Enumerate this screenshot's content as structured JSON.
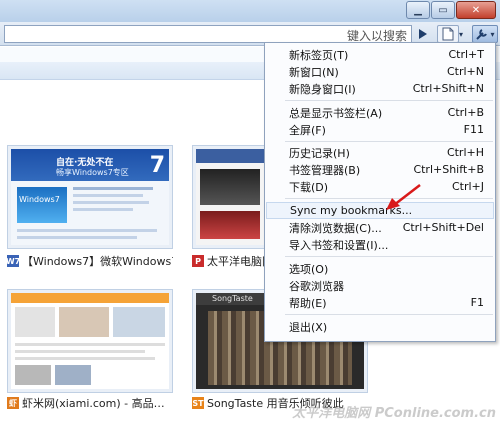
{
  "toolbar": {
    "search_hint": "键入以搜索",
    "window_buttons": [
      "▁",
      "▭",
      "✕"
    ]
  },
  "thumbnails": [
    {
      "caption": "【Windows7】微软Windows7…",
      "favicon": "W7",
      "fav_color": "#3a63b6"
    },
    {
      "caption": "太平洋电脑网",
      "favicon": "P",
      "fav_color": "#c92b2b"
    },
    {
      "caption": "虾米网(xiami.com) - 高品…",
      "favicon": "虾",
      "fav_color": "#e07a1c"
    },
    {
      "caption": "SongTaste 用音乐倾听彼此",
      "favicon": "ST",
      "fav_color": "#e8841a"
    }
  ],
  "thumb_content": {
    "win7_banner": "自在·无处不在",
    "win7_sub": "畅享Windows7专区",
    "win7_logo": "Windows7",
    "songtaste_brand": "SongTaste"
  },
  "menu": {
    "items": [
      {
        "label": "新标签页(T)",
        "shortcut": "Ctrl+T"
      },
      {
        "label": "新窗口(N)",
        "shortcut": "Ctrl+N"
      },
      {
        "label": "新隐身窗口(I)",
        "shortcut": "Ctrl+Shift+N"
      },
      {
        "label": "总是显示书签栏(A)",
        "shortcut": "Ctrl+B"
      },
      {
        "label": "全屏(F)",
        "shortcut": "F11"
      },
      {
        "label": "历史记录(H)",
        "shortcut": "Ctrl+H"
      },
      {
        "label": "书签管理器(B)",
        "shortcut": "Ctrl+Shift+B"
      },
      {
        "label": "下载(D)",
        "shortcut": "Ctrl+J"
      },
      {
        "label": "Sync my bookmarks...",
        "shortcut": ""
      },
      {
        "label": "清除浏览数据(C)...",
        "shortcut": "Ctrl+Shift+Del"
      },
      {
        "label": "导入书签和设置(I)...",
        "shortcut": ""
      },
      {
        "label": "选项(O)",
        "shortcut": ""
      },
      {
        "label": "谷歌浏览器",
        "shortcut": ""
      },
      {
        "label": "帮助(E)",
        "shortcut": "F1"
      },
      {
        "label": "退出(X)",
        "shortcut": ""
      }
    ]
  },
  "watermark": "太平洋电脑网 PConline.com.cn",
  "colors": {
    "accent": "#3a6fb5",
    "arrow": "#d91a1a",
    "menu_highlight": "#eef4fc"
  }
}
